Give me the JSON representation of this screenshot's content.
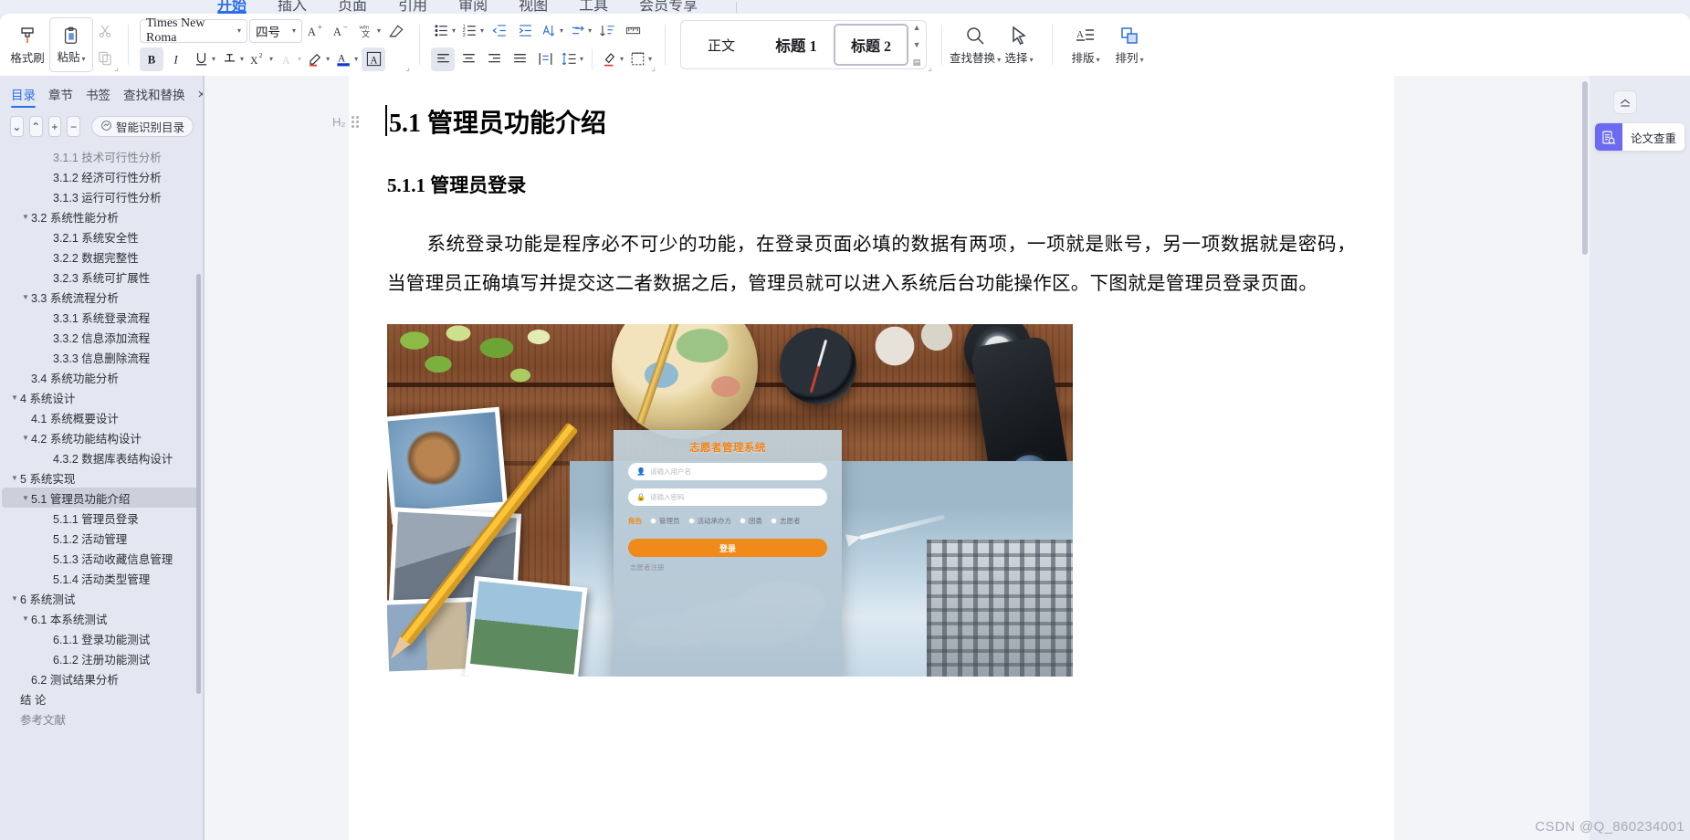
{
  "ribbon_tabs": [
    {
      "label": "开始",
      "active": true
    },
    {
      "label": "插入",
      "active": false
    },
    {
      "label": "页面",
      "active": false
    },
    {
      "label": "引用",
      "active": false
    },
    {
      "label": "审阅",
      "active": false
    },
    {
      "label": "视图",
      "active": false
    },
    {
      "label": "工具",
      "active": false
    },
    {
      "label": "会员专享",
      "active": false
    }
  ],
  "toolbar": {
    "format_painter": "格式刷",
    "paste": "粘贴",
    "font_name": "Times New Roma",
    "font_size": "四号",
    "find_replace": "查找替换",
    "select": "选择",
    "typeset": "排版",
    "arrange": "排列"
  },
  "styles": [
    {
      "label": "正文",
      "active": false
    },
    {
      "label": "标题 1",
      "active": false
    },
    {
      "label": "标题 2",
      "active": true
    }
  ],
  "nav": {
    "tabs": [
      {
        "label": "目录",
        "active": true
      },
      {
        "label": "章节",
        "active": false
      },
      {
        "label": "书签",
        "active": false
      },
      {
        "label": "查找和替换",
        "active": false
      }
    ],
    "close": "×",
    "tools": [
      {
        "name": "expand-down-button",
        "glyph": "⌄"
      },
      {
        "name": "collapse-up-button",
        "glyph": "⌃"
      },
      {
        "name": "increase-level-button",
        "glyph": "+"
      },
      {
        "name": "decrease-level-button",
        "glyph": "−"
      }
    ],
    "smart_toc": "智能识别目录",
    "items": [
      {
        "text": "3.1.1 技术可行性分析",
        "level": 3,
        "arrow": false,
        "selected": false,
        "clipped": true
      },
      {
        "text": "3.1.2 经济可行性分析",
        "level": 3,
        "arrow": false,
        "selected": false
      },
      {
        "text": "3.1.3 运行可行性分析",
        "level": 3,
        "arrow": false,
        "selected": false
      },
      {
        "text": "3.2 系统性能分析",
        "level": 2,
        "arrow": true,
        "selected": false
      },
      {
        "text": "3.2.1  系统安全性",
        "level": 3,
        "arrow": false,
        "selected": false
      },
      {
        "text": "3.2.2  数据完整性",
        "level": 3,
        "arrow": false,
        "selected": false
      },
      {
        "text": "3.2.3 系统可扩展性",
        "level": 3,
        "arrow": false,
        "selected": false
      },
      {
        "text": "3.3 系统流程分析",
        "level": 2,
        "arrow": true,
        "selected": false
      },
      {
        "text": "3.3.1 系统登录流程",
        "level": 3,
        "arrow": false,
        "selected": false
      },
      {
        "text": "3.3.2 信息添加流程",
        "level": 3,
        "arrow": false,
        "selected": false
      },
      {
        "text": "3.3.3 信息删除流程",
        "level": 3,
        "arrow": false,
        "selected": false
      },
      {
        "text": "3.4 系统功能分析",
        "level": 2,
        "arrow": false,
        "selected": false
      },
      {
        "text": "4  系统设计",
        "level": 1,
        "arrow": true,
        "selected": false
      },
      {
        "text": "4.1 系统概要设计",
        "level": 2,
        "arrow": false,
        "selected": false
      },
      {
        "text": "4.2 系统功能结构设计",
        "level": 2,
        "arrow": true,
        "selected": false
      },
      {
        "text": "4.3.2  数据库表结构设计",
        "level": 3,
        "arrow": false,
        "selected": false
      },
      {
        "text": "5  系统实现",
        "level": 1,
        "arrow": true,
        "selected": false
      },
      {
        "text": "5.1 管理员功能介绍",
        "level": 2,
        "arrow": true,
        "selected": true
      },
      {
        "text": "5.1.1 管理员登录",
        "level": 3,
        "arrow": false,
        "selected": false
      },
      {
        "text": "5.1.2  活动管理",
        "level": 3,
        "arrow": false,
        "selected": false
      },
      {
        "text": "5.1.3  活动收藏信息管理",
        "level": 3,
        "arrow": false,
        "selected": false
      },
      {
        "text": "5.1.4 活动类型管理",
        "level": 3,
        "arrow": false,
        "selected": false
      },
      {
        "text": "6 系统测试",
        "level": 1,
        "arrow": true,
        "selected": false
      },
      {
        "text": "6.1  本系统测试",
        "level": 2,
        "arrow": true,
        "selected": false
      },
      {
        "text": "6.1.1  登录功能测试",
        "level": 3,
        "arrow": false,
        "selected": false
      },
      {
        "text": "6.1.2  注册功能测试",
        "level": 3,
        "arrow": false,
        "selected": false
      },
      {
        "text": "6.2 测试结果分析",
        "level": 2,
        "arrow": false,
        "selected": false
      },
      {
        "text": "结   论",
        "level": 1,
        "arrow": false,
        "selected": false
      },
      {
        "text": "参考文献",
        "level": 1,
        "arrow": false,
        "selected": false,
        "clipped": true
      }
    ]
  },
  "document": {
    "heading_marker": "H₂",
    "heading2": "5.1 管理员功能介绍",
    "heading3": "5.1.1 管理员登录",
    "paragraph": "系统登录功能是程序必不可少的功能，在登录页面必填的数据有两项，一项就是账号，另一项数据就是密码，当管理员正确填写并提交这二者数据之后，管理员就可以进入系统后台功能操作区。下图就是管理员登录页面。",
    "figure": {
      "login_title": "志愿者管理系统",
      "username_placeholder": "请输入用户名",
      "password_placeholder": "请输入密码",
      "role_label": "角色",
      "roles": [
        "管理员",
        "活动承办方",
        "团委",
        "志愿者"
      ],
      "login_button": "登录",
      "register_link": "志愿者注册"
    }
  },
  "right_rail": {
    "paper_check": "论文查重"
  },
  "watermark": "CSDN @Q_860234001",
  "colors": {
    "accent": "#2b6fe8",
    "rail_icon": "#6b6af0",
    "login_orange": "#f08a1a",
    "nav_selected": "#ccd0dd"
  }
}
